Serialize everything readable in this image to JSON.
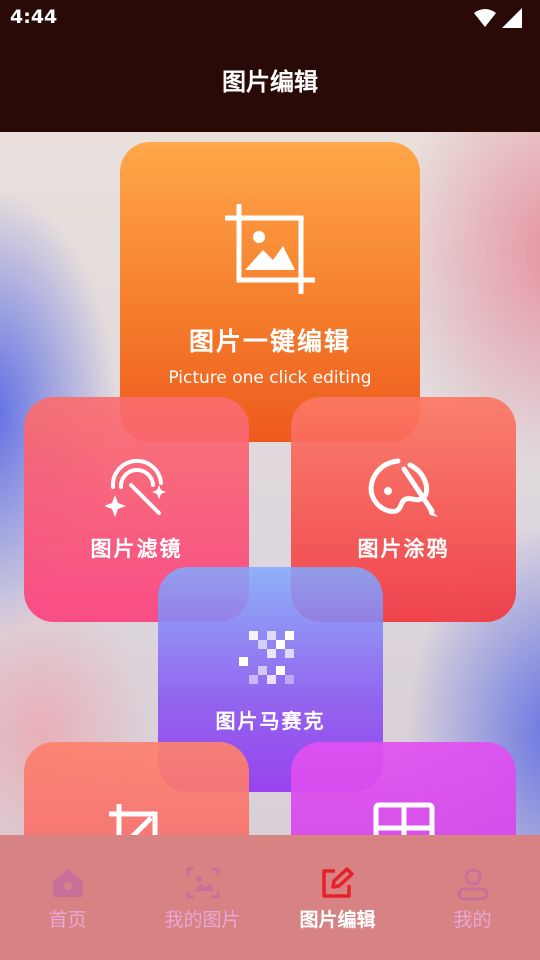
{
  "status_bar": {
    "time": "4:44"
  },
  "app_bar": {
    "title": "图片编辑"
  },
  "cards": {
    "main": {
      "label": "图片一键编辑",
      "sublabel": "Picture one click editing",
      "icon": "image-crop-icon"
    },
    "filter": {
      "label": "图片滤镜",
      "icon": "magic-wand-icon"
    },
    "doodle": {
      "label": "图片涂鸦",
      "icon": "palette-brush-icon"
    },
    "mosaic": {
      "label": "图片马赛克",
      "icon": "mosaic-icon"
    },
    "crop": {
      "label": "",
      "icon": "crop-icon"
    },
    "collage": {
      "label": "",
      "icon": "collage-icon"
    }
  },
  "tabs": [
    {
      "label": "首页",
      "icon": "home-icon",
      "active": false
    },
    {
      "label": "我的图片",
      "icon": "gallery-icon",
      "active": false
    },
    {
      "label": "图片编辑",
      "icon": "edit-icon",
      "active": true
    },
    {
      "label": "我的",
      "icon": "profile-icon",
      "active": false
    }
  ],
  "colors": {
    "header_bg": "#2a0a06",
    "tabbar_bg": "#d78384",
    "tab_inactive": "#e9a6d6",
    "tab_active_icon": "#e8202a"
  }
}
